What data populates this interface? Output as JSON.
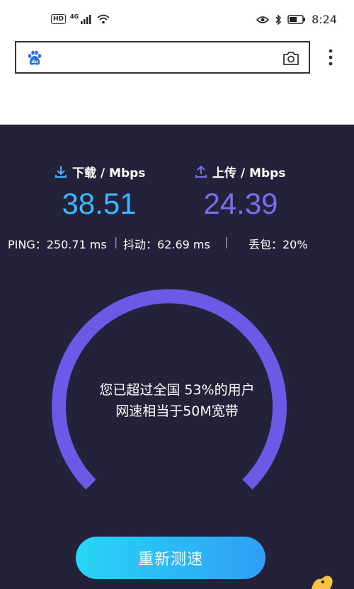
{
  "status_bar": {
    "hd": "HD",
    "network": "4G",
    "time": "8:24"
  },
  "search": {
    "value": "",
    "placeholder": ""
  },
  "stats": {
    "download": {
      "label": "下载 / Mbps",
      "value": "38.51"
    },
    "upload": {
      "label": "上传 / Mbps",
      "value": "24.39"
    }
  },
  "metrics": {
    "ping": "PING：250.71 ms",
    "jitter": "抖动：62.69 ms",
    "loss": "丢包：20%"
  },
  "gauge": {
    "line1": "您已超过全国 53%的用户",
    "line2": "网速相当于50M宽带"
  },
  "actions": {
    "retest": "重新测速"
  },
  "colors": {
    "panel_bg": "#23223a",
    "download_accent": "#3fb6ff",
    "upload_accent": "#7a6df0",
    "gauge_stroke": "#6b5ae6",
    "button_start": "#27d6f5",
    "button_end": "#2f9ef6"
  },
  "icons": {
    "download": "download-arrow-icon",
    "upload": "upload-arrow-icon",
    "camera": "camera-icon",
    "menu": "more-vertical-icon",
    "baidu": "baidu-logo-icon"
  }
}
